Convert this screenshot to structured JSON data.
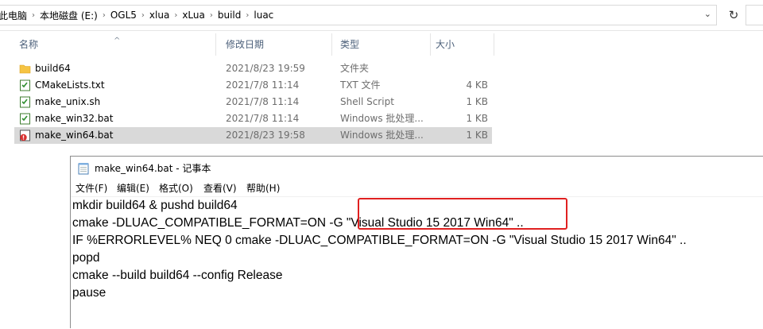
{
  "explorer": {
    "breadcrumbs": [
      "此电脑",
      "本地磁盘 (E:)",
      "OGL5",
      "xlua",
      "xLua",
      "build",
      "luac"
    ],
    "columns": {
      "name": "名称",
      "date": "修改日期",
      "type": "类型",
      "size": "大小"
    },
    "files": [
      {
        "name": "build64",
        "date": "2021/8/23 19:59",
        "type": "文件夹",
        "size": "",
        "icon": "folder-icon",
        "selected": false
      },
      {
        "name": "CMakeLists.txt",
        "date": "2021/7/8 11:14",
        "type": "TXT 文件",
        "size": "4 KB",
        "icon": "text-file-icon",
        "selected": false
      },
      {
        "name": "make_unix.sh",
        "date": "2021/7/8 11:14",
        "type": "Shell Script",
        "size": "1 KB",
        "icon": "shell-script-icon",
        "selected": false
      },
      {
        "name": "make_win32.bat",
        "date": "2021/7/8 11:14",
        "type": "Windows 批处理...",
        "size": "1 KB",
        "icon": "batch-file-icon",
        "selected": false
      },
      {
        "name": "make_win64.bat",
        "date": "2021/8/23 19:58",
        "type": "Windows 批处理...",
        "size": "1 KB",
        "icon": "batch-file-error-icon",
        "selected": true
      }
    ]
  },
  "notepad": {
    "title": "make_win64.bat - 记事本",
    "menu": [
      "文件(F)",
      "编辑(E)",
      "格式(O)",
      "查看(V)",
      "帮助(H)"
    ],
    "lines": [
      "mkdir build64 & pushd build64",
      "cmake -DLUAC_COMPATIBLE_FORMAT=ON -G \"Visual Studio 15 2017 Win64\" ..",
      "IF %ERRORLEVEL% NEQ 0 cmake -DLUAC_COMPATIBLE_FORMAT=ON -G \"Visual Studio 15 2017 Win64\" ..",
      "popd",
      "cmake --build build64 --config Release",
      "pause"
    ]
  },
  "colors": {
    "highlight": "#e02020",
    "selection": "#d9d9d9",
    "header_text": "#4c607a"
  }
}
